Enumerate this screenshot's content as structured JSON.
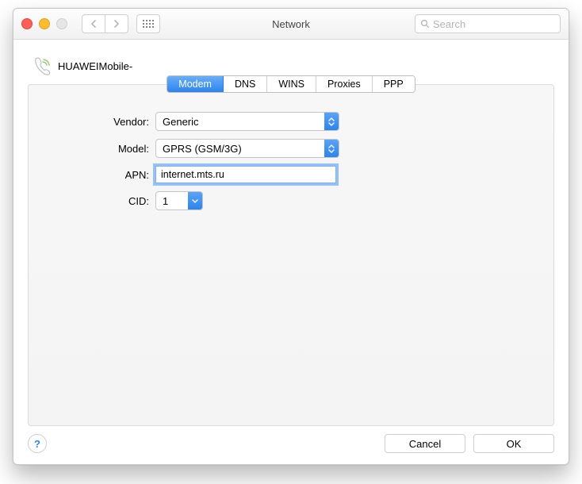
{
  "window": {
    "title": "Network"
  },
  "toolbar": {
    "search_placeholder": "Search"
  },
  "device": {
    "name": "HUAWEIMobile-"
  },
  "tabs": {
    "modem": "Modem",
    "dns": "DNS",
    "wins": "WINS",
    "proxies": "Proxies",
    "ppp": "PPP"
  },
  "form": {
    "vendor_label": "Vendor:",
    "vendor_value": "Generic",
    "model_label": "Model:",
    "model_value": "GPRS (GSM/3G)",
    "apn_label": "APN:",
    "apn_value": "internet.mts.ru",
    "cid_label": "CID:",
    "cid_value": "1"
  },
  "buttons": {
    "cancel": "Cancel",
    "ok": "OK",
    "help": "?"
  }
}
